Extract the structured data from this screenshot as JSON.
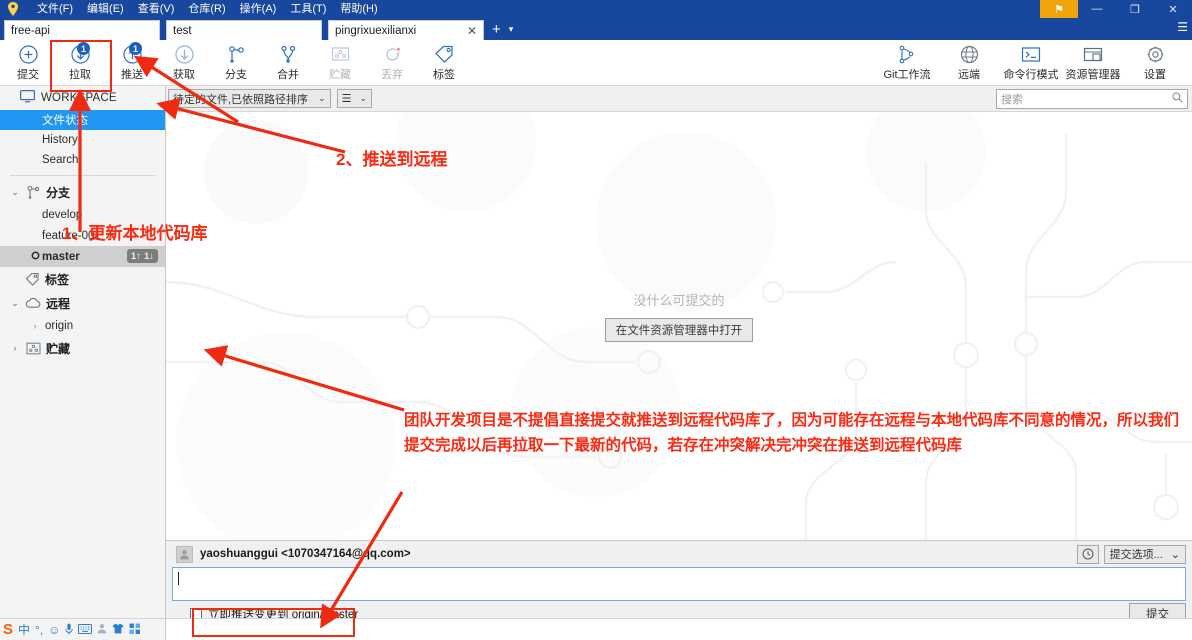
{
  "window": {
    "app_icon": "location-pin-icon",
    "menus": [
      "文件(F)",
      "编辑(E)",
      "查看(V)",
      "仓库(R)",
      "操作(A)",
      "工具(T)",
      "帮助(H)"
    ],
    "flag_button": "⚑",
    "minimize": "—",
    "restore": "❐",
    "close": "✕",
    "hamburger": "☰"
  },
  "tabs": {
    "items": [
      {
        "label": "free-api",
        "active": false,
        "closable": false
      },
      {
        "label": "test",
        "active": false,
        "closable": false
      },
      {
        "label": "pingrixuexilianxi",
        "active": true,
        "closable": true,
        "close_glyph": "✕"
      }
    ],
    "new_tab": "+",
    "tab_menu": "▾"
  },
  "toolbar": {
    "left_buttons": [
      {
        "label": "提交",
        "icon": "commit-plus-icon",
        "badge": null,
        "disabled": false
      },
      {
        "label": "拉取",
        "icon": "pull-down-arrow-icon",
        "badge": "1",
        "disabled": false
      },
      {
        "label": "推送",
        "icon": "push-up-arrow-icon",
        "badge": "1",
        "disabled": false
      },
      {
        "label": "获取",
        "icon": "fetch-down-arrow-icon",
        "badge": null,
        "disabled": false
      },
      {
        "label": "分支",
        "icon": "branch-icon",
        "badge": null,
        "disabled": false
      },
      {
        "label": "合并",
        "icon": "merge-icon",
        "badge": null,
        "disabled": false
      },
      {
        "label": "贮藏",
        "icon": "stash-icon",
        "badge": null,
        "disabled": true
      },
      {
        "label": "丢弃",
        "icon": "discard-icon",
        "badge": null,
        "disabled": true
      },
      {
        "label": "标签",
        "icon": "tag-icon",
        "badge": null,
        "disabled": false
      }
    ],
    "right_buttons": [
      {
        "label": "Git工作流",
        "icon": "gitflow-icon"
      },
      {
        "label": "远端",
        "icon": "globe-remote-icon"
      },
      {
        "label": "命令行模式",
        "icon": "terminal-icon"
      },
      {
        "label": "资源管理器",
        "icon": "folder-explorer-icon"
      },
      {
        "label": "设置",
        "icon": "gear-icon"
      }
    ]
  },
  "subbar": {
    "sort_combo": {
      "value": "待定的文件,已依照路径排序",
      "caret": "⌄"
    },
    "view_combo": {
      "value": "☰",
      "caret": "⌄"
    },
    "search": {
      "placeholder": "搜索",
      "value": "",
      "icon": "search-icon"
    }
  },
  "sidebar": {
    "root": {
      "label": "WORKSPACE",
      "icon": "monitor-icon"
    },
    "workspace_items": [
      {
        "label": "文件状态",
        "selected": true
      },
      {
        "label": "History",
        "selected": false
      },
      {
        "label": "Search",
        "selected": false
      }
    ],
    "sections": [
      {
        "label": "分支",
        "icon": "branch-icon",
        "chevron": "⌄",
        "branches": [
          {
            "label": "develop",
            "current": false,
            "badge": null
          },
          {
            "label": "feature-001",
            "current": false,
            "badge": null
          },
          {
            "label": "master",
            "current": true,
            "badge": {
              "ahead": "1↑",
              "behind": "1↓"
            }
          }
        ]
      },
      {
        "label": "标签",
        "icon": "tag-icon",
        "chevron": "",
        "branches": []
      },
      {
        "label": "远程",
        "icon": "cloud-icon",
        "chevron": "⌄",
        "leaves": [
          {
            "label": "origin",
            "chevron": "›"
          }
        ]
      },
      {
        "label": "贮藏",
        "icon": "stash-icon",
        "chevron": "›",
        "branches": []
      }
    ]
  },
  "main": {
    "empty_message": "没什么可提交的",
    "open_explorer_button": "在文件资源管理器中打开"
  },
  "commit": {
    "author": "yaoshuanggui <1070347164@qq.com>",
    "avatar_icon": "user-avatar-icon",
    "history_icon": "clock-icon",
    "options_button": "提交选项...",
    "options_caret": "⌄",
    "message_value": "",
    "push_checkbox": {
      "label": "立即推送变更到 origin/master",
      "checked": false
    },
    "submit_button": "提交"
  },
  "ime_bar": {
    "icons": [
      "sogou-logo-icon",
      "chinese-mode-icon",
      "punctuation-icon",
      "emoji-icon",
      "mic-icon",
      "keyboard-icon",
      "user-icon",
      "skin-icon",
      "apps-icon"
    ],
    "glyphs": [
      "S",
      "中",
      "°,",
      "☺",
      "🎤",
      "⌨",
      "👤",
      "👕",
      "▦"
    ]
  },
  "annotations": {
    "step1": "1、更新本地代码库",
    "step2": "2、推送到远程",
    "paragraph": "团队开发项目是不提倡直接提交就推送到远程代码库了，因为可能存在远程与本地代码库不同意的情况，所以我们提交完成以后再拉取一下最新的代码，若存在冲突解决完冲突在推送到远程代码库",
    "color": "#fa2a13",
    "box_color": "#ee2b10"
  }
}
